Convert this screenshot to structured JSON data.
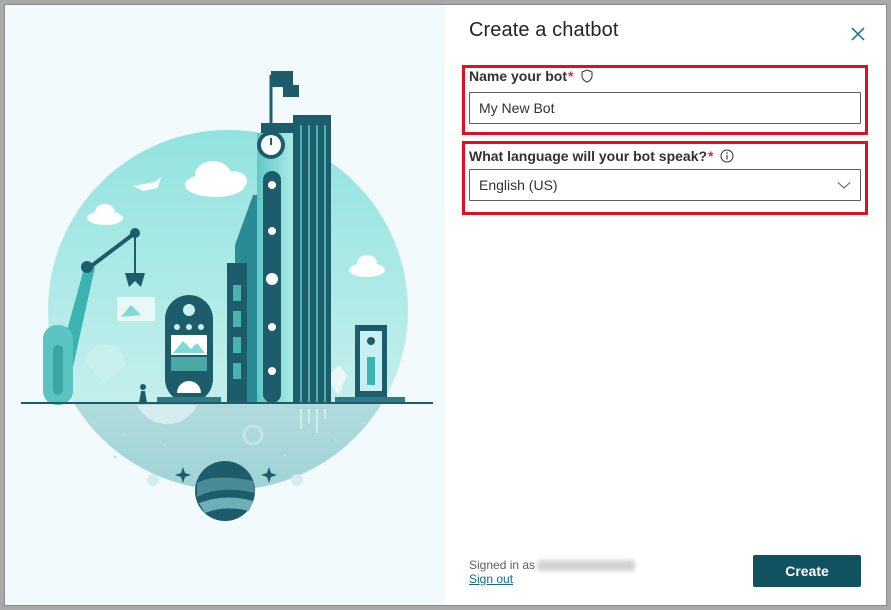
{
  "dialog": {
    "title": "Create a chatbot"
  },
  "name_field": {
    "label": "Name your bot",
    "required_mark": "*",
    "value": "My New Bot"
  },
  "language_field": {
    "label": "What language will your bot speak?",
    "required_mark": "*",
    "selected": "English (US)"
  },
  "footer": {
    "signed_in_prefix": "Signed in as",
    "sign_out": "Sign out",
    "create_label": "Create"
  },
  "colors": {
    "accent": "#10525f",
    "highlight_border": "#e01020",
    "link": "#0f6c8c",
    "illustration_teal": "#7fdad6",
    "illustration_dark": "#1d5c6a"
  },
  "icons": {
    "close": "close-icon",
    "shield": "shield-icon",
    "info": "info-icon",
    "chevron": "chevron-down-icon"
  }
}
